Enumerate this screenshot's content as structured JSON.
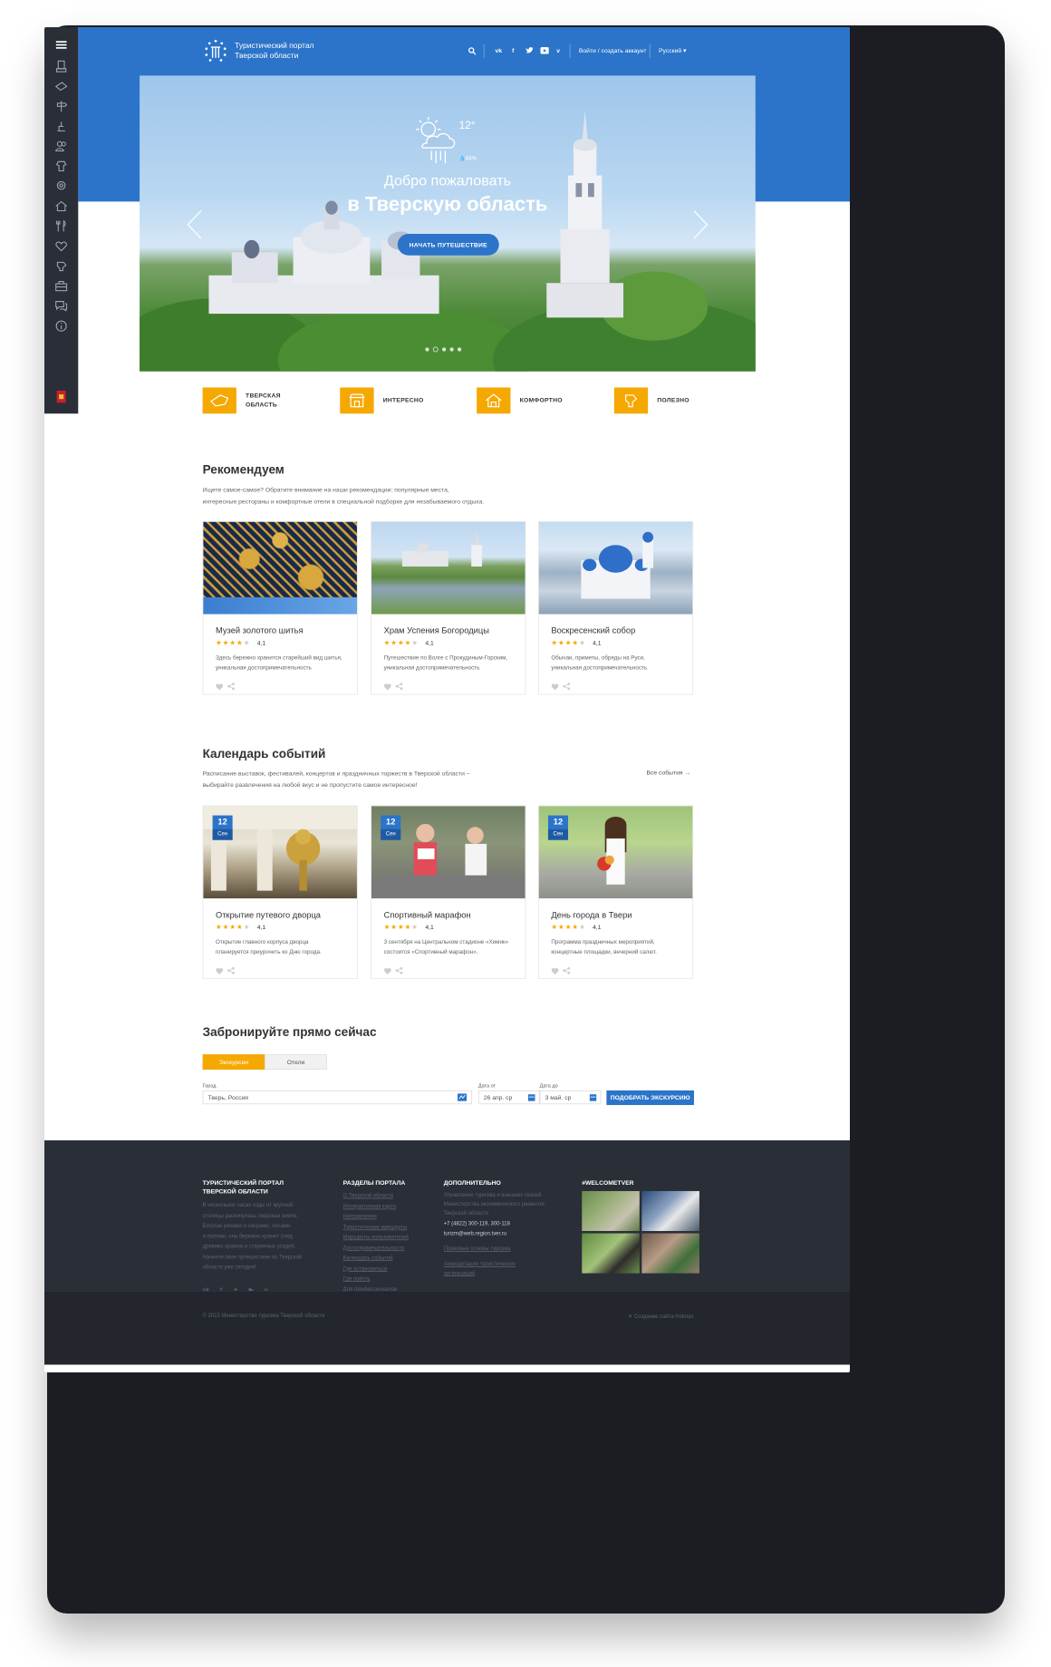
{
  "header": {
    "logo_line1": "Туристический портал",
    "logo_line2": "Тверской области",
    "login": "Войти / создать аккаунт",
    "language": "Русский"
  },
  "social": [
    "vk-icon",
    "facebook-icon",
    "twitter-icon",
    "youtube-icon",
    "vimeo-icon"
  ],
  "sidebar_icons": [
    "menu-icon",
    "monument-icon",
    "ticket-icon",
    "signpost-icon",
    "fishing-icon",
    "people-icon",
    "dress-icon",
    "pin-icon",
    "house-icon",
    "restaurant-icon",
    "heart-icon",
    "hand-icon",
    "briefcase-icon",
    "chat-icon",
    "info-icon",
    "region-emblem-icon"
  ],
  "hero": {
    "temperature": "12°",
    "humidity": "64%",
    "line1": "Добро пожаловать",
    "line2": "в Тверскую область",
    "cta": "НАЧАТЬ ПУТЕШЕСТВИЕ",
    "active_slide": 2,
    "slides": 5
  },
  "categories": [
    {
      "label1": "ТВЕРСКАЯ",
      "label2": "ОБЛАСТЬ",
      "icon": "map-icon"
    },
    {
      "label1": "ИНТЕРЕСНО",
      "label2": "",
      "icon": "camera-icon"
    },
    {
      "label1": "КОМФОРТНО",
      "label2": "",
      "icon": "hotel-icon"
    },
    {
      "label1": "ПОЛЕЗНО",
      "label2": "",
      "icon": "hand-icon"
    }
  ],
  "recommend": {
    "title": "Рекомендуем",
    "desc1": "Ищете самое-самое? Обратите внимание на наши рекомендации: популярные места,",
    "desc2": "интересные рестораны и комфортные отели в специальной подборке для незабываемого отдыха.",
    "cards": [
      {
        "title": "Музей золотого шитья",
        "rating": "4,1",
        "desc1": "Здесь бережно хранится старейший вид шитья,",
        "desc2": "уникальная достопримечательность"
      },
      {
        "title": "Храм Успения Богородицы",
        "rating": "4,1",
        "desc1": "Путешествие по Волге с Прокудиным-Горским,",
        "desc2": "уникальная достопримечательность"
      },
      {
        "title": "Воскресенский собор",
        "rating": "4,1",
        "desc1": "Обычаи, приметы, обряды на Руси,",
        "desc2": "уникальная достопримечательность"
      }
    ]
  },
  "events": {
    "title": "Календарь событий",
    "desc1": "Расписание выставок, фестивалей, концертов и праздничных торжеств в Тверской области –",
    "desc2": "выбирайте развлечения на любой вкус и не пропустите самое интересное!",
    "all_link": "Все события →",
    "cards": [
      {
        "day": "12",
        "month": "Сен",
        "title": "Открытие путевого дворца",
        "rating": "4,1",
        "desc1": "Открытие главного корпуса дворца",
        "desc2": "планируется приурочить ко Дню города."
      },
      {
        "day": "12",
        "month": "Сен",
        "title": "Спортивный марафон",
        "rating": "4,1",
        "desc1": "3 сентября на Центральном стадионе «Химик»",
        "desc2": "состоится «Спортивный марафон»."
      },
      {
        "day": "12",
        "month": "Сен",
        "title": "День города в Твери",
        "rating": "4,1",
        "desc1": "Программа праздничных мероприятий,",
        "desc2": "концертные площадки, вечерний салют."
      }
    ]
  },
  "booking": {
    "title": "Забронируйте прямо сейчас",
    "tab_active": "Экскурсии",
    "tab_other": "Отели",
    "city_label": "Город",
    "city_value": "Тверь, Россия",
    "from_label": "Дата от",
    "from_value": "26 апр. ср",
    "to_label": "Дата до",
    "to_value": "3 май. ср",
    "button": "ПОДОБРАТЬ ЭКСКУРСИЮ"
  },
  "footer": {
    "col1_title1": "ТУРИСТИЧЕСКИЙ ПОРТАЛ",
    "col1_title2": "ТВЕРСКОЙ ОБЛАСТИ",
    "col1_text": [
      "В нескольких часах езды от крупной",
      "столицы раскинулась тверская земля.",
      "Богатая реками и озерами, лесами",
      "и полями, она бережно хранит след",
      "древних храмов и старинных усадеб.",
      "Начните свое путешествие по Тверской",
      "области уже сегодня!"
    ],
    "col2_title": "РАЗДЕЛЫ ПОРТАЛА",
    "col2_links": [
      "О Тверской области",
      "Интерактивная карта",
      "Направления",
      "Туристические маршруты",
      "Маршруты пользователей",
      "Достопримечательности",
      "Календарь событий",
      "Где остановиться",
      "Где поесть",
      "Для профессионалов"
    ],
    "col3_title": "ДОПОЛНИТЕЛЬНО",
    "col3_text": [
      "Управление туризма и внешних связей",
      "Министерства экономического развития",
      "Тверской области"
    ],
    "phone": "+7 (4822) 300-119, 300-118",
    "email": "turizm@web.region.tver.ru",
    "col3_link1": "Правовые основы туризма",
    "col3_link2a": "Аккредитация туристических",
    "col3_link2b": "организаций",
    "col4_title": "#WELCOMETVER",
    "copyright": "© 2013 Министерство туризма Тверской области",
    "made_by": "Создание сайта Holmax"
  }
}
